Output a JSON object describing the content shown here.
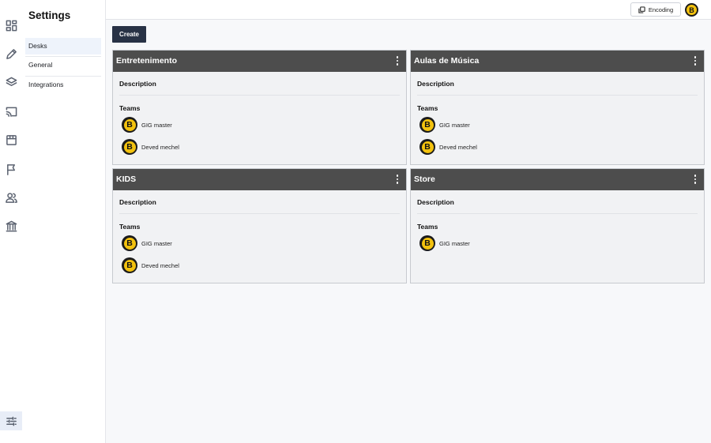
{
  "settings": {
    "title": "Settings",
    "nav": [
      {
        "label": "Desks",
        "active": true
      },
      {
        "label": "General",
        "active": false
      },
      {
        "label": "Integrations",
        "active": false
      }
    ]
  },
  "rail_icons": [
    "dashboard-icon",
    "pencil-icon",
    "layers-icon",
    "cast-icon",
    "store-icon",
    "flag-icon",
    "users-icon",
    "bank-icon",
    "sliders-icon"
  ],
  "topbar": {
    "encoding_label": "Encoding",
    "avatar_letter": "B"
  },
  "create_label": "Create",
  "labels": {
    "description": "Description",
    "teams": "Teams"
  },
  "desks": [
    {
      "name": "Entretenimento",
      "teams": [
        {
          "name": "GIG master",
          "avatar": "B"
        },
        {
          "name": "Deved mechel",
          "avatar": "B"
        }
      ]
    },
    {
      "name": "Aulas de Música",
      "teams": [
        {
          "name": "GIG master",
          "avatar": "B"
        },
        {
          "name": "Deved mechel",
          "avatar": "B"
        }
      ]
    },
    {
      "name": "KIDS",
      "teams": [
        {
          "name": "GIG master",
          "avatar": "B"
        },
        {
          "name": "Deved mechel",
          "avatar": "B"
        }
      ]
    },
    {
      "name": "Store",
      "teams": [
        {
          "name": "GIG master",
          "avatar": "B"
        }
      ]
    }
  ],
  "colors": {
    "card_header": "#4d4d4d",
    "create_button": "#283245",
    "avatar_yellow": "#f3c20e",
    "active_nav": "#eef3fb"
  }
}
